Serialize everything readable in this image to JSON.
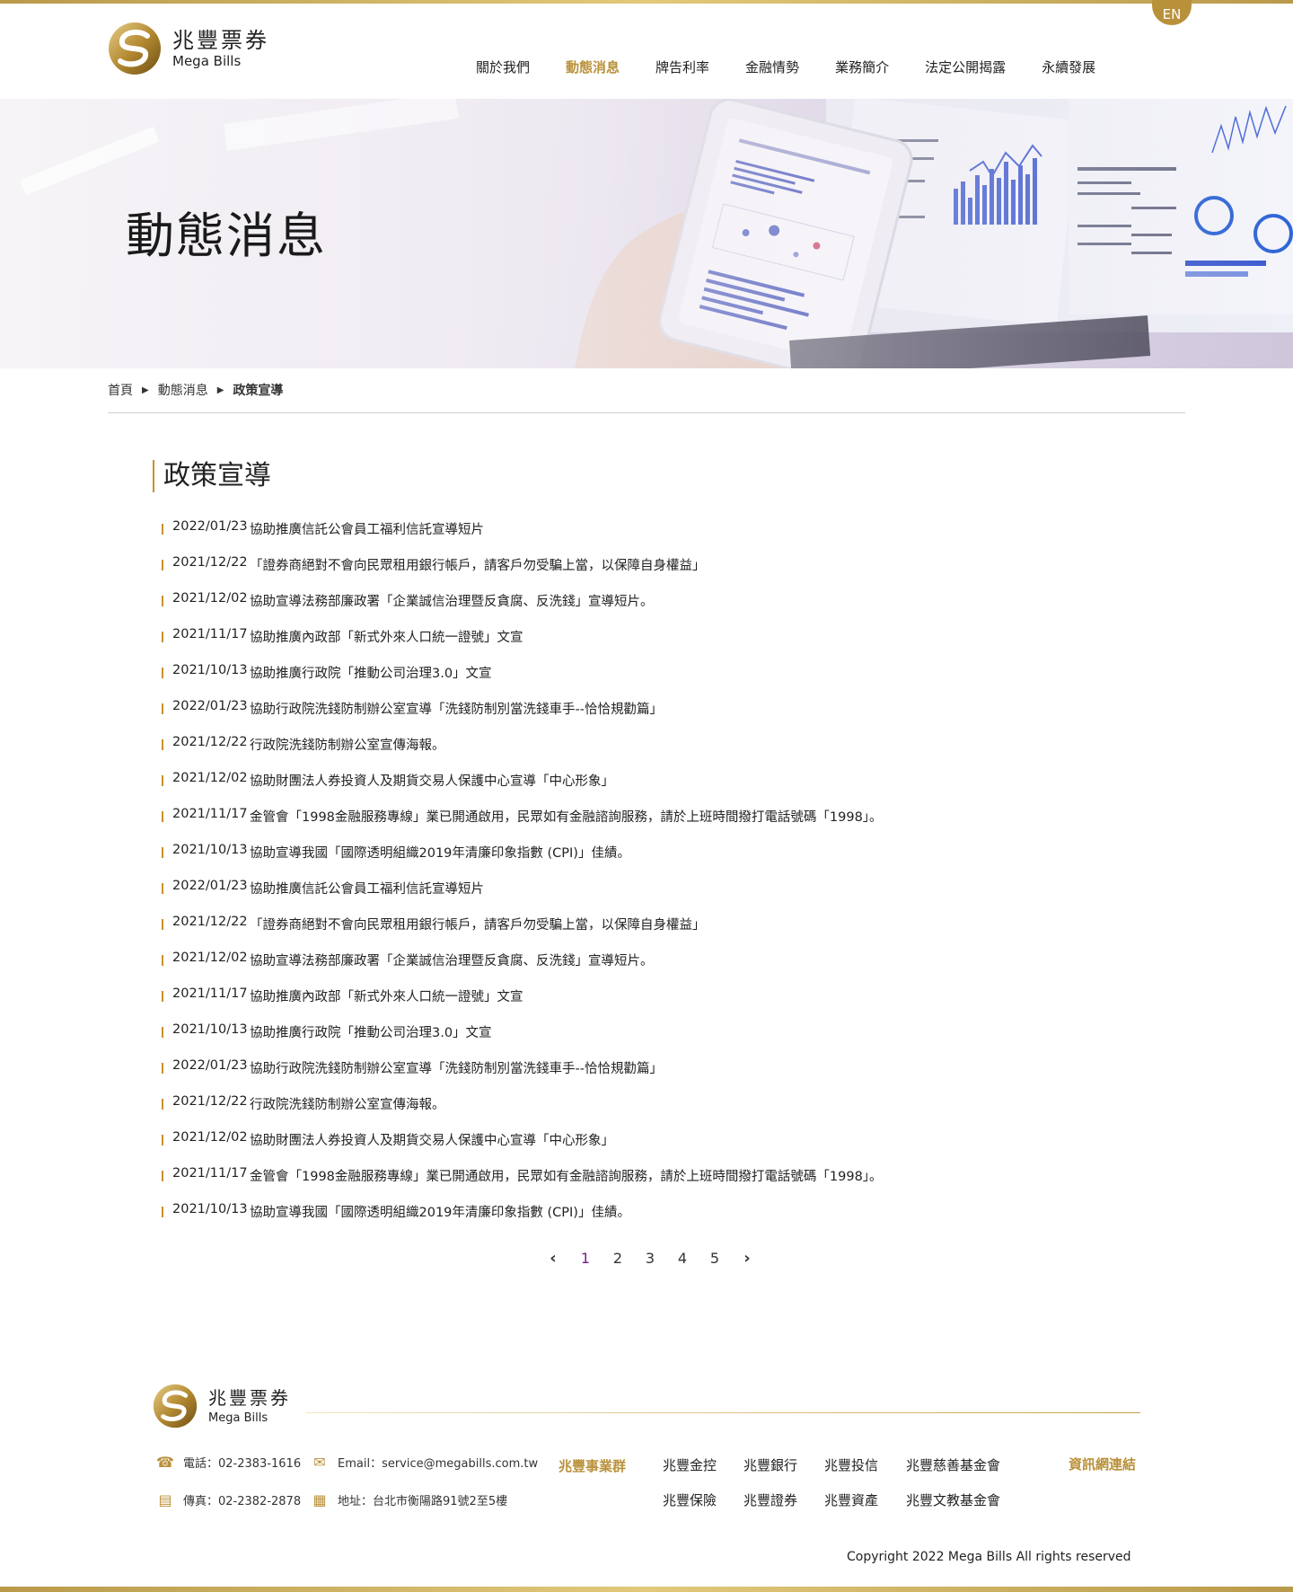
{
  "header": {
    "logo_cn": "兆豐票券",
    "logo_en": "Mega Bills",
    "lang_button": "EN",
    "nav": [
      "關於我們",
      "動態消息",
      "牌告利率",
      "金融情勢",
      "業務簡介",
      "法定公開揭露",
      "永續發展"
    ],
    "active_nav": "動態消息"
  },
  "banner": {
    "title": "動態消息"
  },
  "breadcrumb": {
    "home": "首頁",
    "level1": "動態消息",
    "current": "政策宣導"
  },
  "section": {
    "title": "政策宣導"
  },
  "news": [
    {
      "date": "2022/01/23",
      "title": "協助推廣信託公會員工福利信託宣導短片"
    },
    {
      "date": "2021/12/22",
      "title": "「證券商絕對不會向民眾租用銀行帳戶，請客戶勿受騙上當，以保障自身權益」"
    },
    {
      "date": "2021/12/02",
      "title": "協助宣導法務部廉政署「企業誠信治理暨反貪腐、反洗錢」宣導短片。"
    },
    {
      "date": "2021/11/17",
      "title": "協助推廣內政部「新式外來人口統一證號」文宣"
    },
    {
      "date": "2021/10/13",
      "title": "協助推廣行政院「推動公司治理3.0」文宣"
    },
    {
      "date": "2022/01/23",
      "title": "協助行政院洗錢防制辦公室宣導「洗錢防制別當洗錢車手--恰恰規勸篇」"
    },
    {
      "date": "2021/12/22",
      "title": "行政院洗錢防制辦公室宣傳海報。"
    },
    {
      "date": "2021/12/02",
      "title": "協助財團法人券投資人及期貨交易人保護中心宣導「中心形象」"
    },
    {
      "date": "2021/11/17",
      "title": "金管會「1998金融服務專線」業已開通啟用，民眾如有金融諮詢服務，請於上班時間撥打電話號碼「1998」。"
    },
    {
      "date": "2021/10/13",
      "title": "協助宣導我國「國際透明組織2019年清廉印象指數 (CPI)」佳績。"
    },
    {
      "date": "2022/01/23",
      "title": "協助推廣信託公會員工福利信託宣導短片"
    },
    {
      "date": "2021/12/22",
      "title": "「證券商絕對不會向民眾租用銀行帳戶，請客戶勿受騙上當，以保障自身權益」"
    },
    {
      "date": "2021/12/02",
      "title": "協助宣導法務部廉政署「企業誠信治理暨反貪腐、反洗錢」宣導短片。"
    },
    {
      "date": "2021/11/17",
      "title": "協助推廣內政部「新式外來人口統一證號」文宣"
    },
    {
      "date": "2021/10/13",
      "title": "協助推廣行政院「推動公司治理3.0」文宣"
    },
    {
      "date": "2022/01/23",
      "title": "協助行政院洗錢防制辦公室宣導「洗錢防制別當洗錢車手--恰恰規勸篇」"
    },
    {
      "date": "2021/12/22",
      "title": "行政院洗錢防制辦公室宣傳海報。"
    },
    {
      "date": "2021/12/02",
      "title": "協助財團法人券投資人及期貨交易人保護中心宣導「中心形象」"
    },
    {
      "date": "2021/11/17",
      "title": "金管會「1998金融服務專線」業已開通啟用，民眾如有金融諮詢服務，請於上班時間撥打電話號碼「1998」。"
    },
    {
      "date": "2021/10/13",
      "title": "協助宣導我國「國際透明組織2019年清廉印象指數 (CPI)」佳績。"
    }
  ],
  "pagination": {
    "pages": [
      "1",
      "2",
      "3",
      "4",
      "5"
    ],
    "current": "1",
    "prev_icon": "chevron-left-icon",
    "next_icon": "chevron-right-icon"
  },
  "footer": {
    "logo_cn": "兆豐票券",
    "logo_en": "Mega Bills",
    "phone": "電話：02-2383-1616",
    "email": "Email：service@megabills.com.tw",
    "fax": "傳真：02-2382-2878",
    "address": "地址：台北市衡陽路91號2至5樓",
    "group_label": "兆豐事業群",
    "group_links": [
      "兆豐金控",
      "兆豐銀行",
      "兆豐投信",
      "兆豐慈善基金會",
      "兆豐保險",
      "兆豐證券",
      "兆豐資產",
      "兆豐文教基金會"
    ],
    "info_link": "資訊網連結",
    "copyright": "Copyright 2022 Mega Bills All rights reserved"
  },
  "colors": {
    "accent_gold": "#b9913b",
    "list_bar": "#c8912f",
    "current_page": "#7a1a8a"
  }
}
